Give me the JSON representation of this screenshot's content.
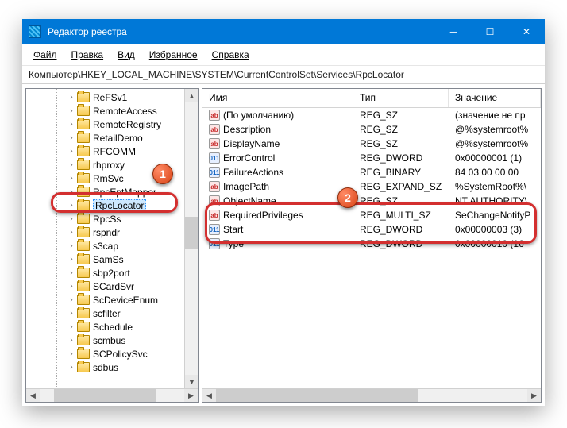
{
  "window": {
    "title": "Редактор реестра"
  },
  "menu": {
    "file": "Файл",
    "edit": "Правка",
    "view": "Вид",
    "favorites": "Избранное",
    "help": "Справка"
  },
  "address": "Компьютер\\HKEY_LOCAL_MACHINE\\SYSTEM\\CurrentControlSet\\Services\\RpcLocator",
  "tree": {
    "items": [
      {
        "label": "ReFSv1"
      },
      {
        "label": "RemoteAccess"
      },
      {
        "label": "RemoteRegistry"
      },
      {
        "label": "RetailDemo"
      },
      {
        "label": "RFCOMM"
      },
      {
        "label": "rhproxy"
      },
      {
        "label": "RmSvc"
      },
      {
        "label": "RpcEptMapper"
      },
      {
        "label": "RpcLocator",
        "selected": true
      },
      {
        "label": "RpcSs"
      },
      {
        "label": "rspndr"
      },
      {
        "label": "s3cap"
      },
      {
        "label": "SamSs"
      },
      {
        "label": "sbp2port"
      },
      {
        "label": "SCardSvr"
      },
      {
        "label": "ScDeviceEnum"
      },
      {
        "label": "scfilter"
      },
      {
        "label": "Schedule"
      },
      {
        "label": "scmbus"
      },
      {
        "label": "SCPolicySvc"
      },
      {
        "label": "sdbus"
      }
    ]
  },
  "list": {
    "columns": {
      "name": "Имя",
      "type": "Тип",
      "value": "Значение"
    },
    "rows": [
      {
        "icon": "str",
        "name": "(По умолчанию)",
        "type": "REG_SZ",
        "value": "(значение не пр"
      },
      {
        "icon": "str",
        "name": "Description",
        "type": "REG_SZ",
        "value": "@%systemroot%"
      },
      {
        "icon": "str",
        "name": "DisplayName",
        "type": "REG_SZ",
        "value": "@%systemroot%"
      },
      {
        "icon": "bin",
        "name": "ErrorControl",
        "type": "REG_DWORD",
        "value": "0x00000001 (1)"
      },
      {
        "icon": "bin",
        "name": "FailureActions",
        "type": "REG_BINARY",
        "value": "84 03 00 00 00"
      },
      {
        "icon": "str",
        "name": "ImagePath",
        "type": "REG_EXPAND_SZ",
        "value": "%SystemRoot%\\"
      },
      {
        "icon": "str",
        "name": "ObjectName",
        "type": "REG_SZ",
        "value": "NT AUTHORITY\\"
      },
      {
        "icon": "str",
        "name": "RequiredPrivileges",
        "type": "REG_MULTI_SZ",
        "value": "SeChangeNotifyP"
      },
      {
        "icon": "bin",
        "name": "Start",
        "type": "REG_DWORD",
        "value": "0x00000003 (3)"
      },
      {
        "icon": "bin",
        "name": "Type",
        "type": "REG_DWORD",
        "value": "0x00000010 (16"
      }
    ]
  },
  "annotations": {
    "badge1": "1",
    "badge2": "2"
  }
}
